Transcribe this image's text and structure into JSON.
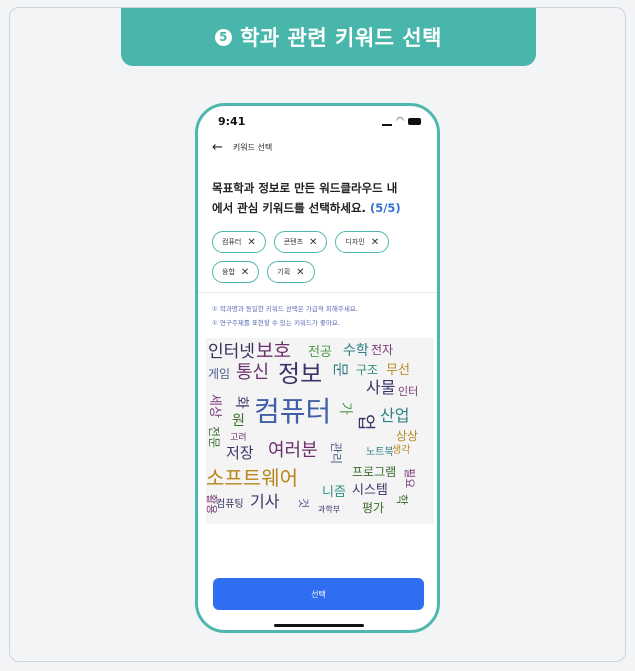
{
  "banner": {
    "step_number": "5",
    "title": "학과 관련 키워드 선택"
  },
  "status_bar": {
    "time": "9:41"
  },
  "nav": {
    "title": "키워드 선택"
  },
  "question": {
    "line1": "목표학과 정보로 만든 워드클라우드 내",
    "line2": "에서 관심 키워드를 선택하세요.",
    "count": "(5/5)"
  },
  "chips": [
    {
      "label": "컴퓨터"
    },
    {
      "label": "콘텐츠"
    },
    {
      "label": "디자인"
    },
    {
      "label": "융합"
    },
    {
      "label": "기획"
    }
  ],
  "notes": {
    "line1": "① 학과명과 동일한 키워드 선택은 가급적 피해주세요.",
    "line2": "① 연구주제를 표현할 수 있는 키워드가 좋아요."
  },
  "word_cloud": {
    "words": [
      {
        "text": "인터넷",
        "color": "#3b2f5c"
      },
      {
        "text": "보호",
        "color": "#6b2f6e"
      },
      {
        "text": "전공",
        "color": "#4a9a4a"
      },
      {
        "text": "수학",
        "color": "#2f7f86"
      },
      {
        "text": "전자",
        "color": "#7a3a78"
      },
      {
        "text": "게임",
        "color": "#4d5a8a"
      },
      {
        "text": "통신",
        "color": "#6b2f6e"
      },
      {
        "text": "정보",
        "color": "#3b3566"
      },
      {
        "text": "문",
        "color": "#2f7f86"
      },
      {
        "text": "구조",
        "color": "#2f8f7f"
      },
      {
        "text": "무선",
        "color": "#b88a22"
      },
      {
        "text": "사물",
        "color": "#3b3566"
      },
      {
        "text": "인터",
        "color": "#7a3a78"
      },
      {
        "text": "세상",
        "color": "#7a3a78"
      },
      {
        "text": "화",
        "color": "#3b3566"
      },
      {
        "text": "원",
        "color": "#3b6e2f"
      },
      {
        "text": "컴퓨터",
        "color": "#3f5fa8"
      },
      {
        "text": "가",
        "color": "#4a9a4a"
      },
      {
        "text": "산업",
        "color": "#2f7f86"
      },
      {
        "text": "업",
        "color": "#3b3566"
      },
      {
        "text": "전문",
        "color": "#3b6e2f"
      },
      {
        "text": "고려",
        "color": "#7a3a78"
      },
      {
        "text": "상상",
        "color": "#b88a22"
      },
      {
        "text": "저장",
        "color": "#3b3566"
      },
      {
        "text": "여러분",
        "color": "#6b2f6e"
      },
      {
        "text": "관리",
        "color": "#4d5a8a"
      },
      {
        "text": "노트북",
        "color": "#2f7f86"
      },
      {
        "text": "생각",
        "color": "#b88a22"
      },
      {
        "text": "소프트웨어",
        "color": "#b8861b"
      },
      {
        "text": "프로그램",
        "color": "#3b6e2f"
      },
      {
        "text": "필요",
        "color": "#7a3a78"
      },
      {
        "text": "니즘",
        "color": "#2f8f7f"
      },
      {
        "text": "시스템",
        "color": "#3b3566"
      },
      {
        "text": "컴퓨팅",
        "color": "#3b3566"
      },
      {
        "text": "기사",
        "color": "#3b3566"
      },
      {
        "text": "것",
        "color": "#4d5a8a"
      },
      {
        "text": "과학부",
        "color": "#3b3566"
      },
      {
        "text": "평가",
        "color": "#3b6e2f"
      },
      {
        "text": "학",
        "color": "#3b6e2f"
      },
      {
        "text": "활용",
        "color": "#7a3a78"
      }
    ]
  },
  "select_button": {
    "label": "선택"
  }
}
